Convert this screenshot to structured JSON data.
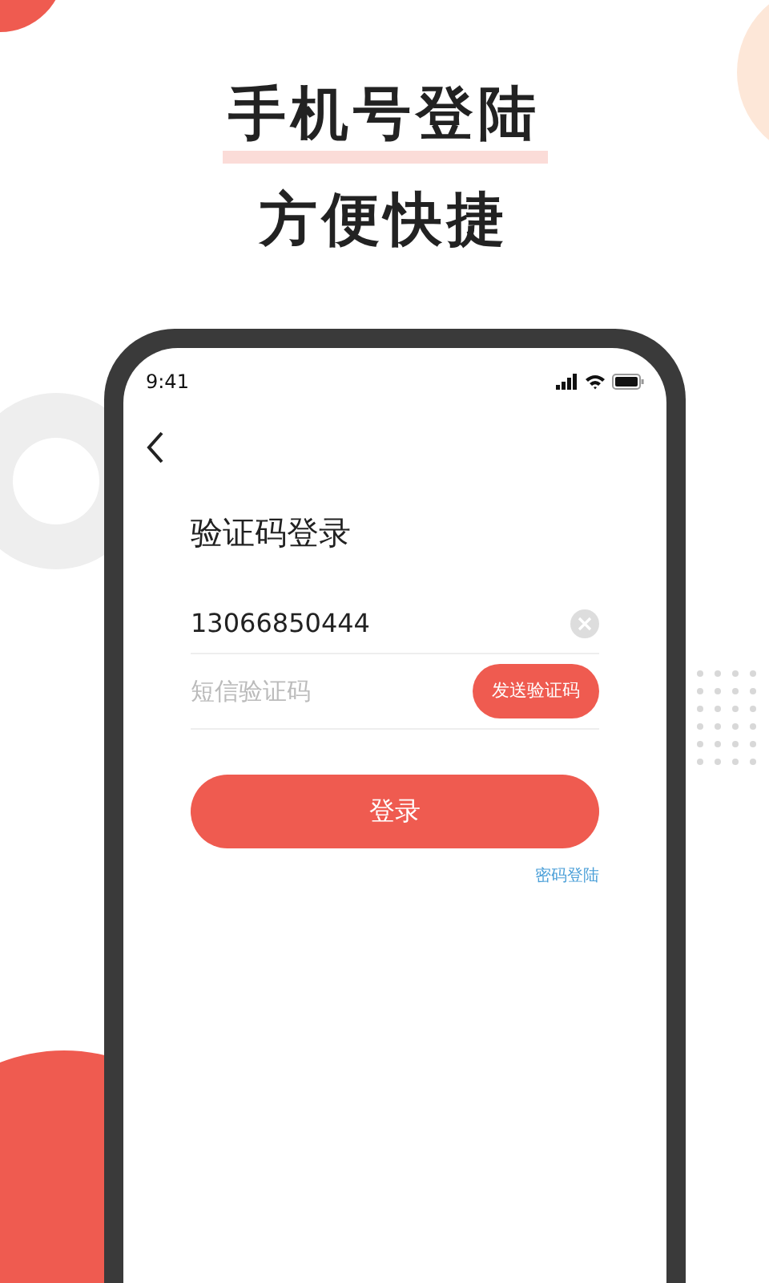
{
  "headline": [
    "手机号登陆",
    "方便快捷"
  ],
  "status_bar": {
    "time": "9:41"
  },
  "screen": {
    "title": "验证码登录",
    "phone_field": {
      "value": "13066850444"
    },
    "code_field": {
      "placeholder": "短信验证码"
    },
    "send_code_button": "发送验证码",
    "login_button": "登录",
    "password_login_link": "密码登陆"
  }
}
